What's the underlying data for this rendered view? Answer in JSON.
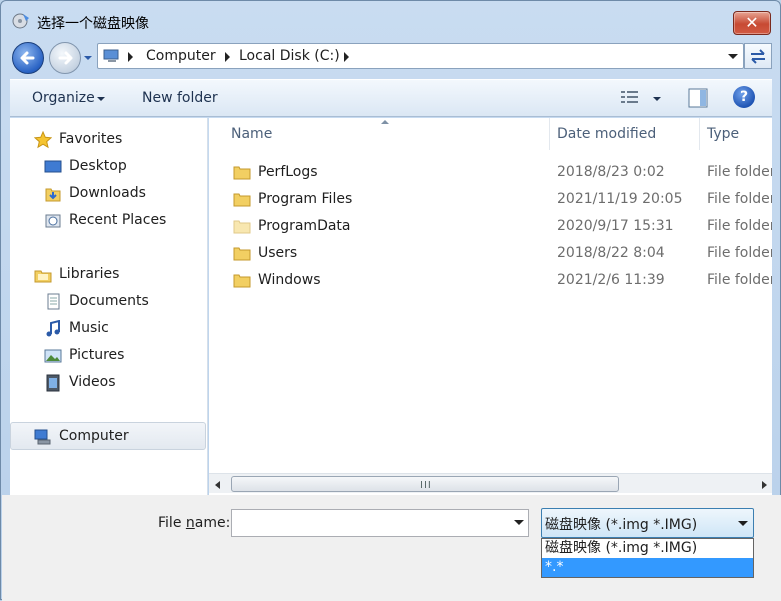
{
  "window": {
    "title": "选择一个磁盘映像",
    "close_label": "✕"
  },
  "address": {
    "crumbs": [
      "Computer",
      "Local Disk (C:)"
    ]
  },
  "toolbar": {
    "organize_label": "Organize",
    "new_folder_label": "New folder",
    "help_label": "?"
  },
  "navpane": {
    "favorites": {
      "label": "Favorites",
      "items": [
        "Desktop",
        "Downloads",
        "Recent Places"
      ]
    },
    "libraries": {
      "label": "Libraries",
      "items": [
        "Documents",
        "Music",
        "Pictures",
        "Videos"
      ]
    },
    "computer": {
      "label": "Computer"
    }
  },
  "columns": {
    "name": "Name",
    "date": "Date modified",
    "type": "Type"
  },
  "files": [
    {
      "name": "PerfLogs",
      "date": "2018/8/23 0:02",
      "type": "File folder"
    },
    {
      "name": "Program Files",
      "date": "2021/11/19 20:05",
      "type": "File folder"
    },
    {
      "name": "ProgramData",
      "date": "2020/9/17 15:31",
      "type": "File folder"
    },
    {
      "name": "Users",
      "date": "2018/8/22 8:04",
      "type": "File folder"
    },
    {
      "name": "Windows",
      "date": "2021/2/6 11:39",
      "type": "File folder"
    }
  ],
  "scrollbar": {
    "grip": "III"
  },
  "bottom": {
    "file_name_label_pre": "File ",
    "file_name_label_ul": "n",
    "file_name_label_post": "ame:",
    "file_name_value": "",
    "type_selected": "磁盘映像 (*.img *.IMG)",
    "type_options": [
      "磁盘映像 (*.img *.IMG)",
      "*.*"
    ]
  }
}
